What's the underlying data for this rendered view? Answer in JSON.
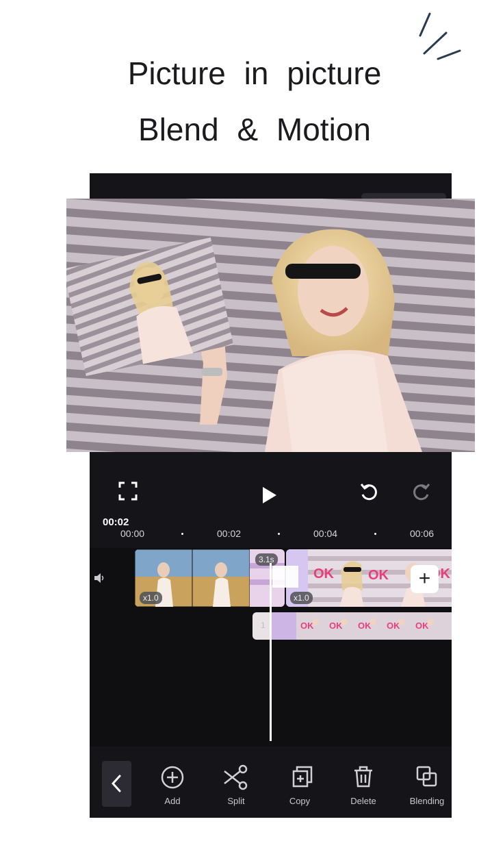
{
  "headline": {
    "line1": "Picture in picture",
    "line2": "Blend & Motion"
  },
  "controls": {
    "fullscreen_icon": "fullscreen-icon",
    "play_icon": "play-icon",
    "undo_icon": "undo-icon",
    "redo_icon": "redo-icon"
  },
  "timeline": {
    "current_time": "00:02",
    "ticks": [
      "00:00",
      "00:02",
      "00:04",
      "00:06"
    ],
    "clip1_speed": "x1.0",
    "clip2_speed": "x1.0",
    "transition_badge": "3.1s",
    "overlay_track_index": "1",
    "add_clip_label": "+"
  },
  "toolbar": {
    "items": [
      {
        "label": "Add",
        "icon": "add-circle-icon"
      },
      {
        "label": "Split",
        "icon": "scissors-icon"
      },
      {
        "label": "Copy",
        "icon": "copy-icon"
      },
      {
        "label": "Delete",
        "icon": "trash-icon"
      },
      {
        "label": "Blending",
        "icon": "blend-icon"
      }
    ]
  },
  "colors": {
    "panel": "#151419",
    "timeline": "#0f0f12",
    "text_light": "#ffffff",
    "sticker_pink": "#e83f7a"
  }
}
